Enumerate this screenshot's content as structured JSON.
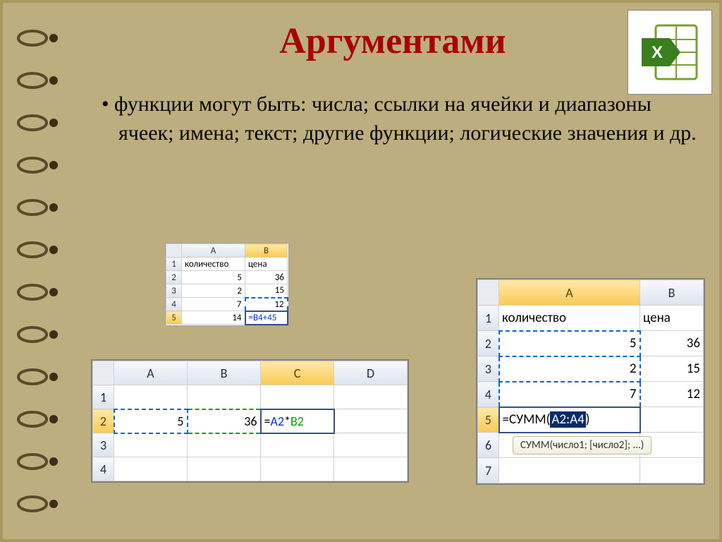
{
  "title": "Аргументами",
  "bullet": "функции могут быть: числа; ссылки на ячейки и диапазоны ячеек; имена; текст; другие функции; логические значения и др.",
  "sheet1": {
    "columns": [
      "A",
      "B"
    ],
    "headers": [
      "количество",
      "цена"
    ],
    "rows": [
      [
        "5",
        "36"
      ],
      [
        "2",
        "15"
      ],
      [
        "7",
        "12"
      ],
      [
        "14",
        "=B4+45"
      ]
    ]
  },
  "sheet2": {
    "columns": [
      "A",
      "B",
      "C",
      "D"
    ],
    "row2": {
      "a": "5",
      "b": "36",
      "c_formula_prefix": "=",
      "c_ref1": "A2",
      "c_op": "*",
      "c_ref2": "B2"
    }
  },
  "sheet3": {
    "columns": [
      "A",
      "B"
    ],
    "headers": [
      "количество",
      "цена"
    ],
    "rows": [
      [
        "5",
        "36"
      ],
      [
        "2",
        "15"
      ],
      [
        "7",
        "12"
      ]
    ],
    "formula_prefix": "=СУММ(",
    "formula_range": "A2:A4",
    "formula_suffix": ")",
    "tooltip": "СУММ(число1; [число2]; ...)"
  }
}
